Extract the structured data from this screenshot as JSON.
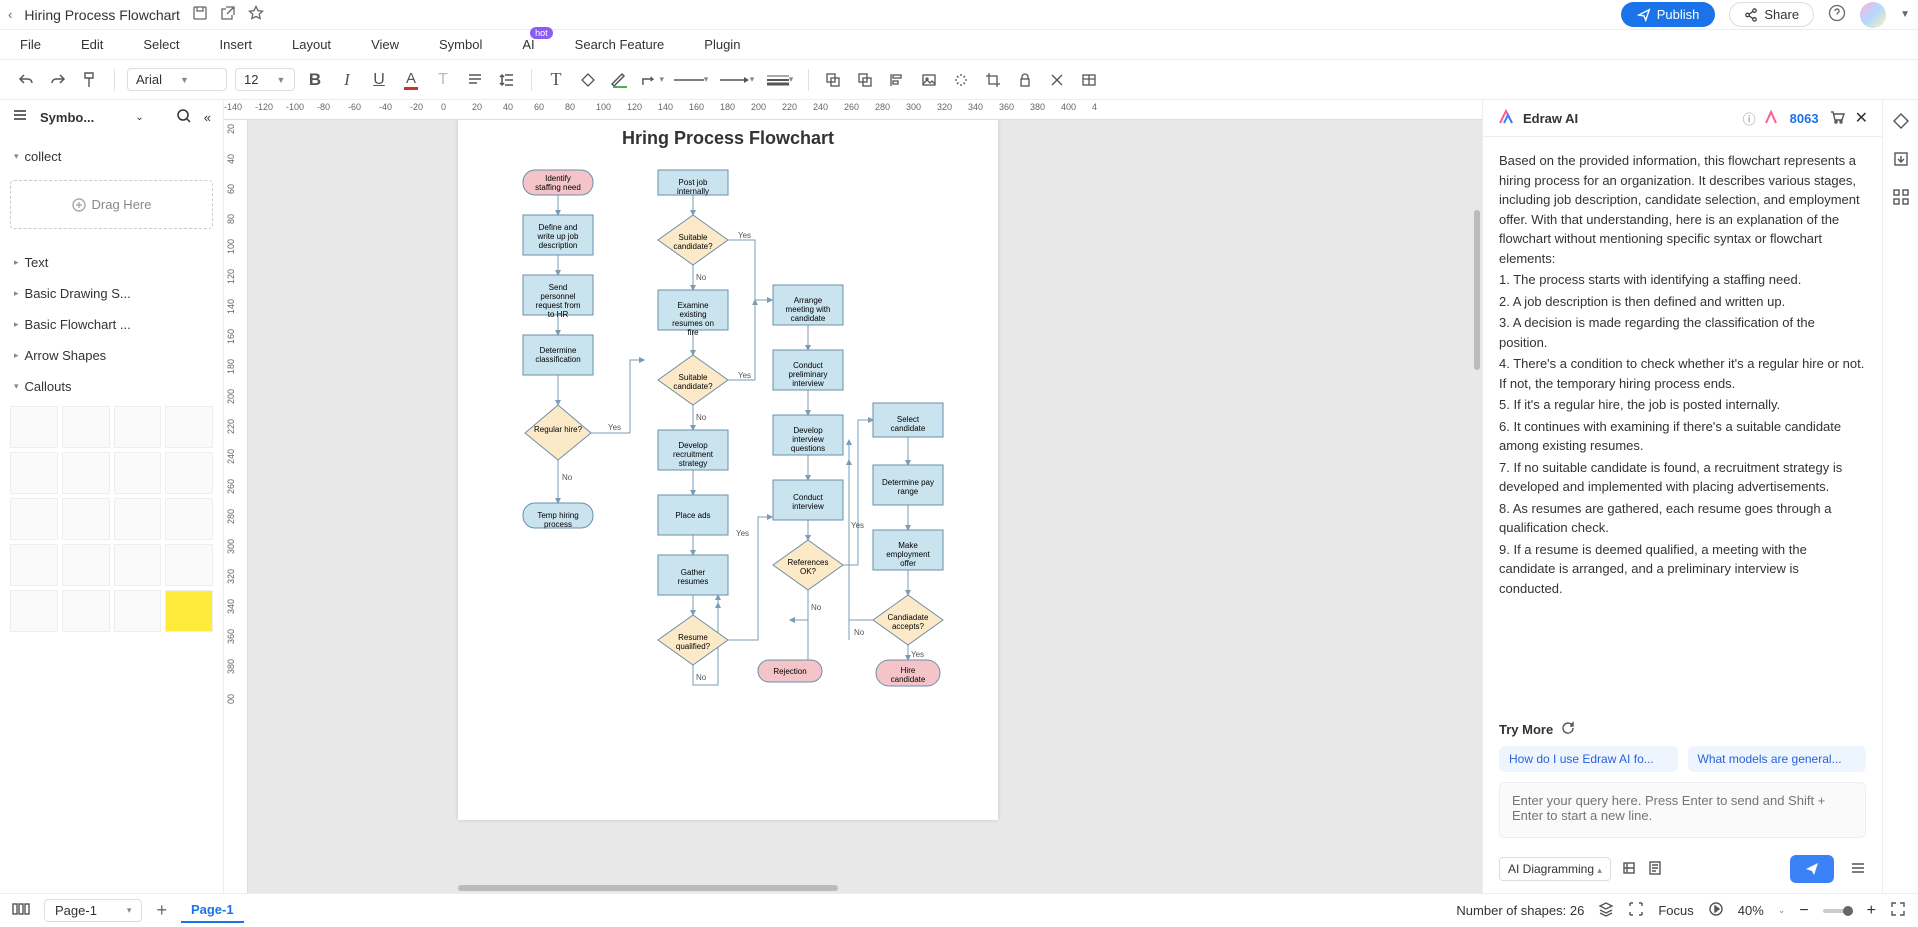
{
  "titlebar": {
    "doc_title": "Hiring Process Flowchart",
    "publish": "Publish",
    "share": "Share"
  },
  "menubar": [
    "File",
    "Edit",
    "Select",
    "Insert",
    "Layout",
    "View",
    "Symbol",
    "AI",
    "Search Feature",
    "Plugin"
  ],
  "hot_badge": "hot",
  "toolbar": {
    "font": "Arial",
    "size": "12"
  },
  "left_panel": {
    "title": "Symbo...",
    "sections": [
      "collect",
      "Text",
      "Basic Drawing S...",
      "Basic Flowchart ...",
      "Arrow Shapes",
      "Callouts"
    ],
    "drag_here": "Drag Here"
  },
  "ruler_h": [
    "-140",
    "-120",
    "-100",
    "-80",
    "-60",
    "-40",
    "-20",
    "0",
    "20",
    "40",
    "60",
    "80",
    "100",
    "120",
    "140",
    "160",
    "180",
    "200",
    "220",
    "240",
    "260",
    "280",
    "300",
    "320",
    "340",
    "360",
    "380",
    "400",
    "4"
  ],
  "ruler_v": [
    "20",
    "40",
    "60",
    "80",
    "100",
    "120",
    "140",
    "160",
    "180",
    "200",
    "220",
    "240",
    "260",
    "280",
    "300",
    "320",
    "340",
    "360",
    "380",
    "00"
  ],
  "canvas": {
    "title": "Hring Process Flowchart",
    "nodes": {
      "n1": "Identify staffing need",
      "n2": "Define and write up job description",
      "n3": "Send personnel request from to HR",
      "n4": "Determine classification",
      "n5": "Regular hire?",
      "n6": "Temp hiring process",
      "n7": "Post job internally",
      "n8": "Suitable candidate?",
      "n9": "Examine existing resumes on fire",
      "n10": "Suitable candidate?",
      "n11": "Develop recruitment strategy",
      "n12": "Place ads",
      "n13": "Gather resumes",
      "n14": "Resume qualified?",
      "n15": "Arrange meeting with candidate",
      "n16": "Conduct preliminary interview",
      "n17": "Develop interview questions",
      "n18": "Conduct interview",
      "n19": "References OK?",
      "n20": "Rejection",
      "n21": "Select candidate",
      "n22": "Determine pay range",
      "n23": "Make employment offer",
      "n24": "Candiadate accepts?",
      "n25": "Hire candidate"
    },
    "labels": {
      "yes": "Yes",
      "no": "No"
    }
  },
  "ai_panel": {
    "title": "Edraw AI",
    "points": "8063",
    "body": [
      "Based on the provided information, this flowchart represents a hiring process for an organization. It describes various stages, including job description, candidate selection, and employment offer. With that understanding, here is an explanation of the flowchart without mentioning specific syntax or flowchart elements:",
      "1. The process starts with identifying a staffing need.",
      "2. A job description is then defined and written up.",
      "3. A decision is made regarding the classification of the position.",
      "4. There's a condition to check whether it's a regular hire or not. If not, the temporary hiring process ends.",
      "5. If it's a regular hire, the job is posted internally.",
      "6. It continues with examining if there's a suitable candidate among existing resumes.",
      "7. If no suitable candidate is found, a recruitment strategy is developed and implemented with placing advertisements.",
      "8. As resumes are gathered, each resume goes through a qualification check.",
      "9. If a resume is deemed qualified, a meeting with the candidate is arranged, and a preliminary interview is conducted."
    ],
    "try_more": "Try More",
    "chips": [
      "How do I use Edraw AI fo...",
      "What models are general..."
    ],
    "placeholder": "Enter your query here. Press Enter to send and Shift + Enter to start a new line.",
    "mode": "AI Diagramming"
  },
  "statusbar": {
    "page_dropdown": "Page-1",
    "active_tab": "Page-1",
    "shapes": "Number of shapes: 26",
    "focus": "Focus",
    "zoom": "40%"
  }
}
